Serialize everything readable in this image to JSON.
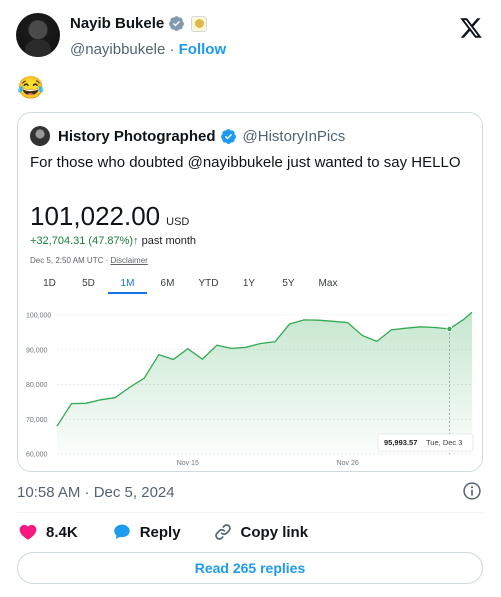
{
  "tweet": {
    "author_name": "Nayib Bukele",
    "author_handle": "@nayibbukele",
    "follow_label": "Follow",
    "dot": "·",
    "text": "😂",
    "time": "10:58 AM · Dec 5, 2024",
    "likes": "8.4K",
    "reply_label": "Reply",
    "copy_label": "Copy link",
    "read_replies": "Read 265 replies"
  },
  "quote": {
    "author_name": "History Photographed",
    "author_handle": "@HistoryInPics",
    "text": "For those who doubted @nayibbukele just wanted to say HELLO",
    "price": "101,022.00",
    "currency": "USD",
    "change": "+32,704.31 (47.87%)↑",
    "change_period": "past month",
    "timestamp": "Dec 5, 2:50 AM UTC · ",
    "disclaimer": "Disclaimer",
    "ranges": [
      "1D",
      "5D",
      "1M",
      "6M",
      "YTD",
      "1Y",
      "5Y",
      "Max"
    ],
    "active_range": "1M"
  },
  "colors": {
    "accent": "#1d9bf0",
    "like": "#f91880",
    "gain": "#188038",
    "chart_line": "#34a853"
  },
  "icons": [
    "verified-badge-icon",
    "affiliate-badge-icon",
    "x-logo-icon",
    "info-icon",
    "heart-icon",
    "reply-icon",
    "link-icon"
  ],
  "chart_data": {
    "type": "area",
    "y_ticks": [
      "100,000",
      "90,000",
      "80,000",
      "70,000",
      "60,000"
    ],
    "ylim": [
      60000,
      101000
    ],
    "x_ticks": [
      {
        "label": "Nov 15",
        "x": 9
      },
      {
        "label": "Nov 26",
        "x": 20
      }
    ],
    "x": [
      0,
      1,
      2,
      3,
      4,
      5,
      6,
      7,
      8,
      9,
      10,
      11,
      12,
      13,
      14,
      15,
      16,
      17,
      18,
      19,
      20,
      21,
      22,
      23,
      24,
      25,
      26,
      27,
      28
    ],
    "values": [
      68000,
      74500,
      74600,
      75600,
      76200,
      79200,
      81800,
      88600,
      87200,
      90300,
      87300,
      91300,
      90400,
      90700,
      91800,
      92300,
      97400,
      98600,
      98500,
      98200,
      97800,
      94100,
      92400,
      95700,
      96200,
      96600,
      96400,
      95993.57,
      98800
    ],
    "extra_point": {
      "x": 28.55,
      "value": 100800
    },
    "tooltip": {
      "value": "95,993.57",
      "date": "Tue, Dec 3",
      "x": 27
    }
  }
}
